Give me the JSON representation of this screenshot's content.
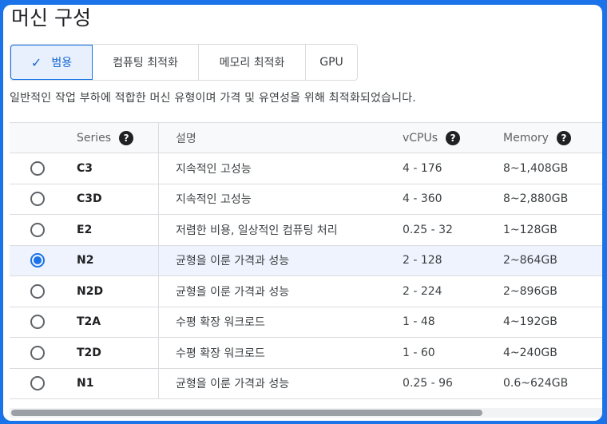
{
  "title": "머신 구성",
  "tabs": [
    {
      "label": "범용",
      "selected": true
    },
    {
      "label": "컴퓨팅 최적화",
      "selected": false
    },
    {
      "label": "메모리 최적화",
      "selected": false
    },
    {
      "label": "GPU",
      "selected": false
    }
  ],
  "description": "일반적인 작업 부하에 적합한 머신 유형이며 가격 및 유연성을 위해 최적화되었습니다.",
  "table": {
    "headers": {
      "series": "Series",
      "desc": "설명",
      "vcpus": "vCPUs",
      "memory": "Memory"
    },
    "rows": [
      {
        "series": "C3",
        "desc": "지속적인 고성능",
        "vcpus": "4 - 176",
        "memory": "8~1,408GB",
        "selected": false
      },
      {
        "series": "C3D",
        "desc": "지속적인 고성능",
        "vcpus": "4 - 360",
        "memory": "8~2,880GB",
        "selected": false
      },
      {
        "series": "E2",
        "desc": "저렴한 비용, 일상적인 컴퓨팅 처리",
        "vcpus": "0.25 - 32",
        "memory": "1~128GB",
        "selected": false
      },
      {
        "series": "N2",
        "desc": "균형을 이룬 가격과 성능",
        "vcpus": "2 - 128",
        "memory": "2~864GB",
        "selected": true
      },
      {
        "series": "N2D",
        "desc": "균형을 이룬 가격과 성능",
        "vcpus": "2 - 224",
        "memory": "2~896GB",
        "selected": false
      },
      {
        "series": "T2A",
        "desc": "수평 확장 워크로드",
        "vcpus": "1 - 48",
        "memory": "4~192GB",
        "selected": false
      },
      {
        "series": "T2D",
        "desc": "수평 확장 워크로드",
        "vcpus": "1 - 60",
        "memory": "4~240GB",
        "selected": false
      },
      {
        "series": "N1",
        "desc": "균형을 이룬 가격과 성능",
        "vcpus": "0.25 - 96",
        "memory": "0.6~624GB",
        "selected": false
      }
    ]
  },
  "colors": {
    "accent": "#1a73e8",
    "selected_row": "#eef3fd"
  }
}
